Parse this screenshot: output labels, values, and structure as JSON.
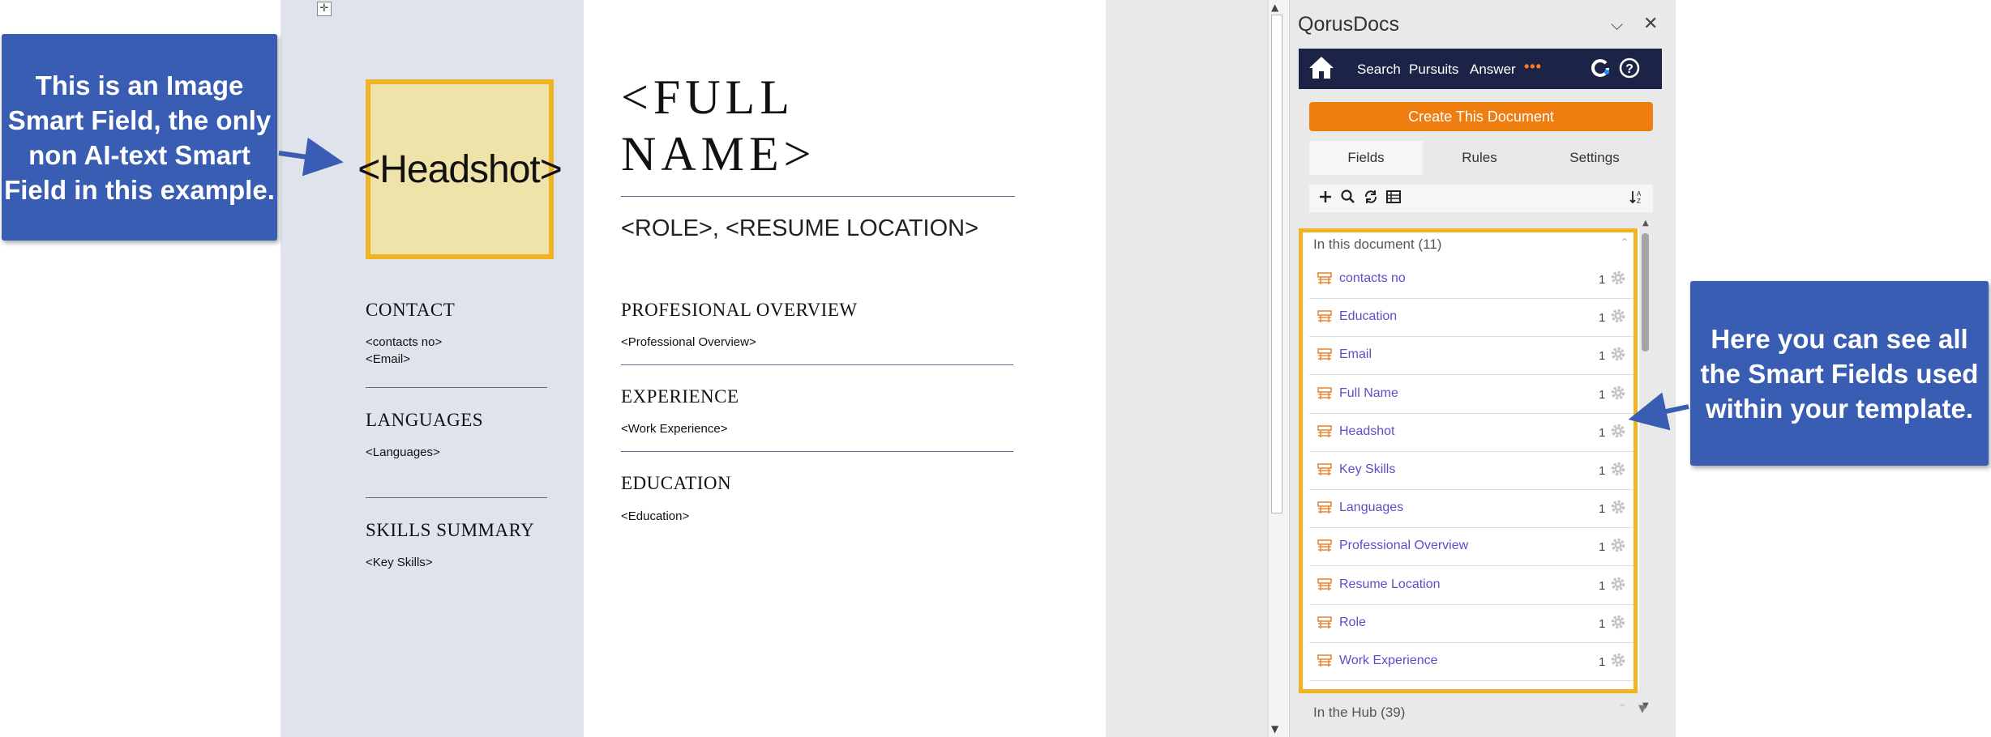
{
  "document": {
    "headshot_label": "<Headshot>",
    "full_name_line1": "<FULL",
    "full_name_line2": "NAME>",
    "role_line": "<ROLE>, <RESUME LOCATION>",
    "sidebar": {
      "contact_heading": "CONTACT",
      "contact_line1": "<contacts no>",
      "contact_line2": "<Email>",
      "languages_heading": "LANGUAGES",
      "languages_text": "<Languages>",
      "skills_heading": "SKILLS SUMMARY",
      "skills_text": "<Key Skills>"
    },
    "main": {
      "overview_heading": "PROFESIONAL OVERVIEW",
      "overview_text": "<Professional Overview>",
      "experience_heading": "EXPERIENCE",
      "experience_text": "<Work Experience>",
      "education_heading": "EDUCATION",
      "education_text": "<Education>"
    }
  },
  "pane": {
    "title": "QorusDocs",
    "nav": {
      "search": "Search",
      "pursuits": "Pursuits",
      "answer": "Answer",
      "more": "•••"
    },
    "create_button": "Create This Document",
    "tabs": {
      "fields": "Fields",
      "rules": "Rules",
      "settings": "Settings"
    },
    "list_header": "In this document (11)",
    "fields": [
      {
        "name": "contacts no",
        "count": "1"
      },
      {
        "name": "Education",
        "count": "1"
      },
      {
        "name": "Email",
        "count": "1"
      },
      {
        "name": "Full Name",
        "count": "1"
      },
      {
        "name": "Headshot",
        "count": "1"
      },
      {
        "name": "Key Skills",
        "count": "1"
      },
      {
        "name": "Languages",
        "count": "1"
      },
      {
        "name": "Professional Overview",
        "count": "1"
      },
      {
        "name": "Resume Location",
        "count": "1"
      },
      {
        "name": "Role",
        "count": "1"
      },
      {
        "name": "Work Experience",
        "count": "1"
      }
    ],
    "hub_label": "In the Hub (39)"
  },
  "callouts": {
    "left": "This is an Image Smart Field, the only non AI-text Smart Field in this example.",
    "right": "Here you can see all the Smart Fields used within your template."
  },
  "colors": {
    "navbar": "#1b2346",
    "accent_orange": "#f07d10",
    "highlight": "#f0b323",
    "callout_blue": "#3a5db4",
    "field_link": "#5a4fc8"
  }
}
